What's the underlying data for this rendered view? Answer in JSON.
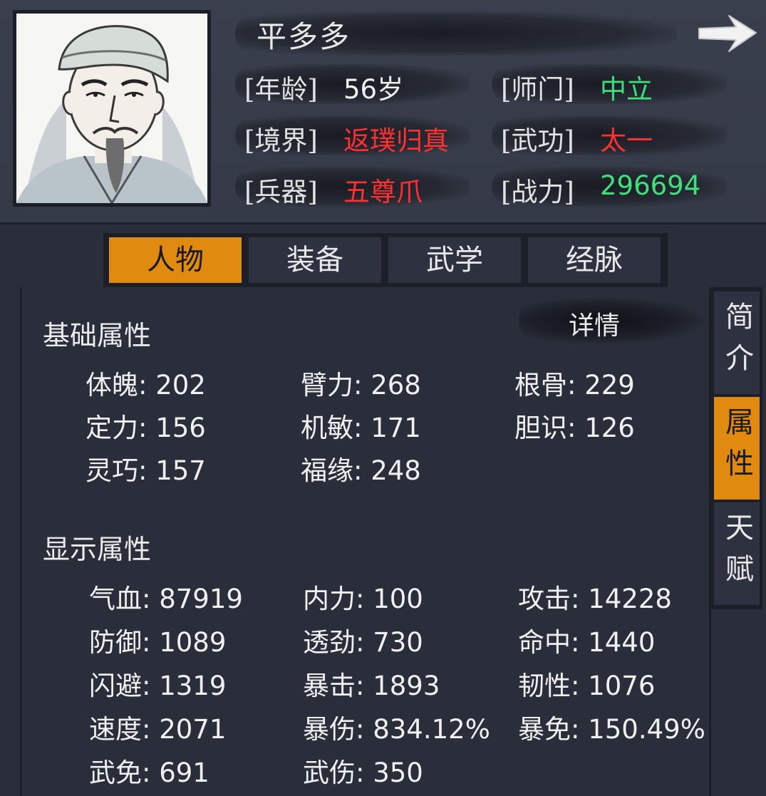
{
  "character": {
    "name": "平多多",
    "age_label": "[年龄]",
    "age_value": "56岁",
    "sect_label": "[师门]",
    "sect_value": "中立",
    "realm_label": "[境界]",
    "realm_value": "返璞归真",
    "skill_label": "[武功]",
    "skill_value": "太一",
    "weapon_label": "[兵器]",
    "weapon_value": "五尊爪",
    "power_label": "[战力]",
    "power_value": "296694"
  },
  "colors": {
    "accent": "#e08a10",
    "red": "#ff3030",
    "green": "#3ee07a"
  },
  "tabs": [
    "人物",
    "装备",
    "武学",
    "经脉"
  ],
  "active_tab": "人物",
  "side_tabs": [
    "简介",
    "属性",
    "天赋"
  ],
  "active_side_tab": "属性",
  "detail_label": "详情",
  "base_section": {
    "title": "基础属性",
    "stats": [
      "体魄: 202",
      "臂力: 268",
      "根骨: 229",
      "定力: 156",
      "机敏: 171",
      "胆识: 126",
      "灵巧: 157",
      "福缘: 248"
    ]
  },
  "display_section": {
    "title": "显示属性",
    "stats": [
      "气血: 87919",
      "内力: 100",
      "攻击: 14228",
      "防御: 1089",
      "透劲: 730",
      "命中: 1440",
      "闪避: 1319",
      "暴击: 1893",
      "韧性: 1076",
      "速度: 2071",
      "暴伤: 834.12%",
      "暴免: 150.49%",
      "武免: 691",
      "武伤: 350"
    ]
  },
  "icons": {
    "next": "right-arrow-icon",
    "portrait": "character-portrait"
  }
}
